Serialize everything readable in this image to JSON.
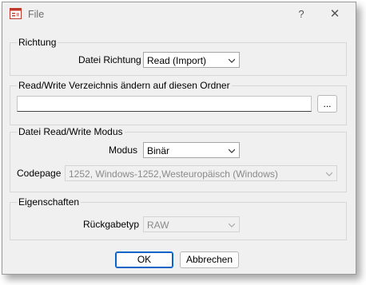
{
  "window": {
    "title": "File",
    "help_glyph": "?",
    "close_glyph": "✕",
    "icon": "app-window-icon"
  },
  "richtung": {
    "legend": "Richtung",
    "label": "Datei Richtung",
    "value": "Read (Import)"
  },
  "verzeichnis": {
    "legend": "Read/Write Verzeichnis ändern auf diesen Ordner",
    "path_value": "",
    "browse_label": "..."
  },
  "modus_group": {
    "legend": "Datei Read/Write Modus",
    "modus_label": "Modus",
    "modus_value": "Binär",
    "codepage_label": "Codepage",
    "codepage_value": "1252, Windows-1252,Westeuropäisch (Windows)"
  },
  "eigenschaften": {
    "legend": "Eigenschaften",
    "rueckgabe_label": "Rückgabetyp",
    "rueckgabe_value": "RAW"
  },
  "footer": {
    "ok_label": "OK",
    "cancel_label": "Abbrechen"
  },
  "colors": {
    "window_bg": "#f0f0f0",
    "default_button_border": "#0a64c8",
    "icon_red": "#c0392b"
  }
}
